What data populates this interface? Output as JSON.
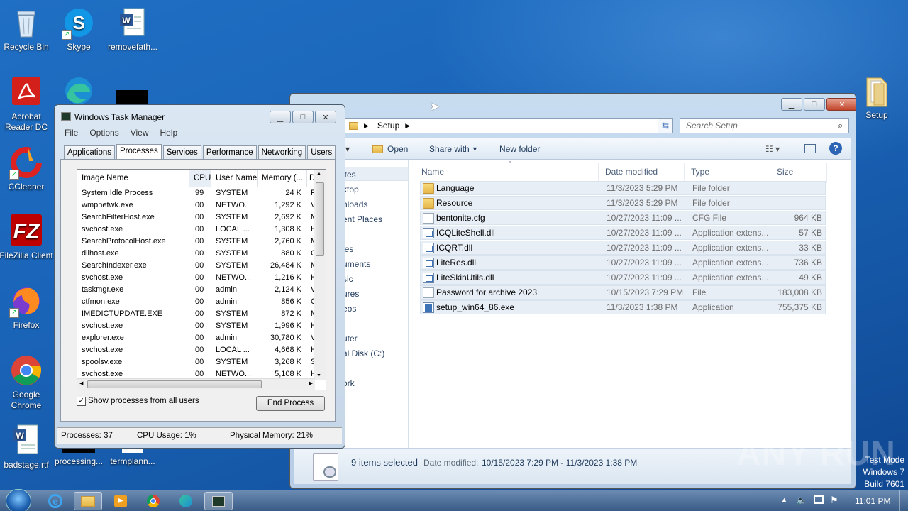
{
  "desktop": {
    "icons": [
      {
        "label": "Recycle Bin"
      },
      {
        "label": "Skype"
      },
      {
        "label": "removefath..."
      },
      {
        "label": "Acrobat Reader DC"
      },
      {
        "label": "CCleaner"
      },
      {
        "label": "FileZilla Client"
      },
      {
        "label": "Firefox"
      },
      {
        "label": "Google Chrome"
      },
      {
        "label": "badstage.rtf"
      },
      {
        "label": "processing..."
      },
      {
        "label": "termplann..."
      },
      {
        "label": "Setup"
      }
    ],
    "watermark": "ANY RUN",
    "test_mode": [
      "Test Mode",
      "Windows 7",
      "Build 7601"
    ]
  },
  "explorer": {
    "address_crumb": "Setup",
    "search_placeholder": "Search Setup",
    "toolbar": {
      "open": "Open",
      "share_with": "Share with",
      "new_folder": "New folder"
    },
    "nav_items": [
      "ites",
      "ktop",
      "nloads",
      "ent Places",
      "ies",
      "uments",
      "sic",
      "ures",
      "eos",
      "uter",
      "al Disk (C:)",
      "ork"
    ],
    "columns": {
      "name": "Name",
      "date": "Date modified",
      "type": "Type",
      "size": "Size"
    },
    "files": [
      {
        "name": "Language",
        "date": "11/3/2023 5:29 PM",
        "type": "File folder",
        "size": "",
        "icon": "folder"
      },
      {
        "name": "Resource",
        "date": "11/3/2023 5:29 PM",
        "type": "File folder",
        "size": "",
        "icon": "folder"
      },
      {
        "name": "bentonite.cfg",
        "date": "10/27/2023 11:09 ...",
        "type": "CFG File",
        "size": "964 KB",
        "icon": "doc"
      },
      {
        "name": "ICQLiteShell.dll",
        "date": "10/27/2023 11:09 ...",
        "type": "Application extens...",
        "size": "57 KB",
        "icon": "dll"
      },
      {
        "name": "ICQRT.dll",
        "date": "10/27/2023 11:09 ...",
        "type": "Application extens...",
        "size": "33 KB",
        "icon": "dll"
      },
      {
        "name": "LiteRes.dll",
        "date": "10/27/2023 11:09 ...",
        "type": "Application extens...",
        "size": "736 KB",
        "icon": "dll"
      },
      {
        "name": "LiteSkinUtils.dll",
        "date": "10/27/2023 11:09 ...",
        "type": "Application extens...",
        "size": "49 KB",
        "icon": "dll"
      },
      {
        "name": "Password for archive 2023",
        "date": "10/15/2023 7:29 PM",
        "type": "File",
        "size": "183,008 KB",
        "icon": "doc"
      },
      {
        "name": "setup_win64_86.exe",
        "date": "11/3/2023 1:38 PM",
        "type": "Application",
        "size": "755,375 KB",
        "icon": "exe"
      }
    ],
    "details": {
      "selected": "9 items selected",
      "date_label": "Date modified:",
      "date_range": "10/15/2023 7:29 PM - 11/3/2023 1:38 PM"
    }
  },
  "taskmgr": {
    "title": "Windows Task Manager",
    "menu": [
      "File",
      "Options",
      "View",
      "Help"
    ],
    "tabs": [
      "Applications",
      "Processes",
      "Services",
      "Performance",
      "Networking",
      "Users"
    ],
    "columns": [
      "Image Name",
      "CPU",
      "User Name",
      "Memory (...",
      "D"
    ],
    "processes": [
      {
        "name": "System Idle Process",
        "cpu": "99",
        "user": "SYSTEM",
        "mem": "24 K",
        "d": "F"
      },
      {
        "name": "wmpnetwk.exe",
        "cpu": "00",
        "user": "NETWO...",
        "mem": "1,292 K",
        "d": "V"
      },
      {
        "name": "SearchFilterHost.exe",
        "cpu": "00",
        "user": "SYSTEM",
        "mem": "2,692 K",
        "d": "M"
      },
      {
        "name": "svchost.exe",
        "cpu": "00",
        "user": "LOCAL ...",
        "mem": "1,308 K",
        "d": "H"
      },
      {
        "name": "SearchProtocolHost.exe",
        "cpu": "00",
        "user": "SYSTEM",
        "mem": "2,760 K",
        "d": "M"
      },
      {
        "name": "dllhost.exe",
        "cpu": "00",
        "user": "SYSTEM",
        "mem": "880 K",
        "d": "C"
      },
      {
        "name": "SearchIndexer.exe",
        "cpu": "00",
        "user": "SYSTEM",
        "mem": "26,484 K",
        "d": "M"
      },
      {
        "name": "svchost.exe",
        "cpu": "00",
        "user": "NETWO...",
        "mem": "1,216 K",
        "d": "H"
      },
      {
        "name": "taskmgr.exe",
        "cpu": "00",
        "user": "admin",
        "mem": "2,124 K",
        "d": "V"
      },
      {
        "name": "ctfmon.exe",
        "cpu": "00",
        "user": "admin",
        "mem": "856 K",
        "d": "C"
      },
      {
        "name": "IMEDICTUPDATE.EXE",
        "cpu": "00",
        "user": "SYSTEM",
        "mem": "872 K",
        "d": "M"
      },
      {
        "name": "svchost.exe",
        "cpu": "00",
        "user": "SYSTEM",
        "mem": "1,996 K",
        "d": "H"
      },
      {
        "name": "explorer.exe",
        "cpu": "00",
        "user": "admin",
        "mem": "30,780 K",
        "d": "V"
      },
      {
        "name": "svchost.exe",
        "cpu": "00",
        "user": "LOCAL ...",
        "mem": "4,668 K",
        "d": "H"
      },
      {
        "name": "spoolsv.exe",
        "cpu": "00",
        "user": "SYSTEM",
        "mem": "3,268 K",
        "d": "S"
      },
      {
        "name": "svchost.exe",
        "cpu": "00",
        "user": "NETWO...",
        "mem": "5,108 K",
        "d": "H"
      }
    ],
    "show_all_label": "Show processes from all users",
    "show_all_checked": true,
    "end_process": "End Process",
    "status": {
      "processes": "Processes: 37",
      "cpu": "CPU Usage: 1%",
      "memory": "Physical Memory: 21%"
    }
  },
  "taskbar": {
    "clock": "11:01 PM",
    "items": [
      "start-orb",
      "ie-icon",
      "explorer-icon",
      "media-player-icon",
      "chrome-icon",
      "edge-icon",
      "taskmgr-icon"
    ]
  }
}
